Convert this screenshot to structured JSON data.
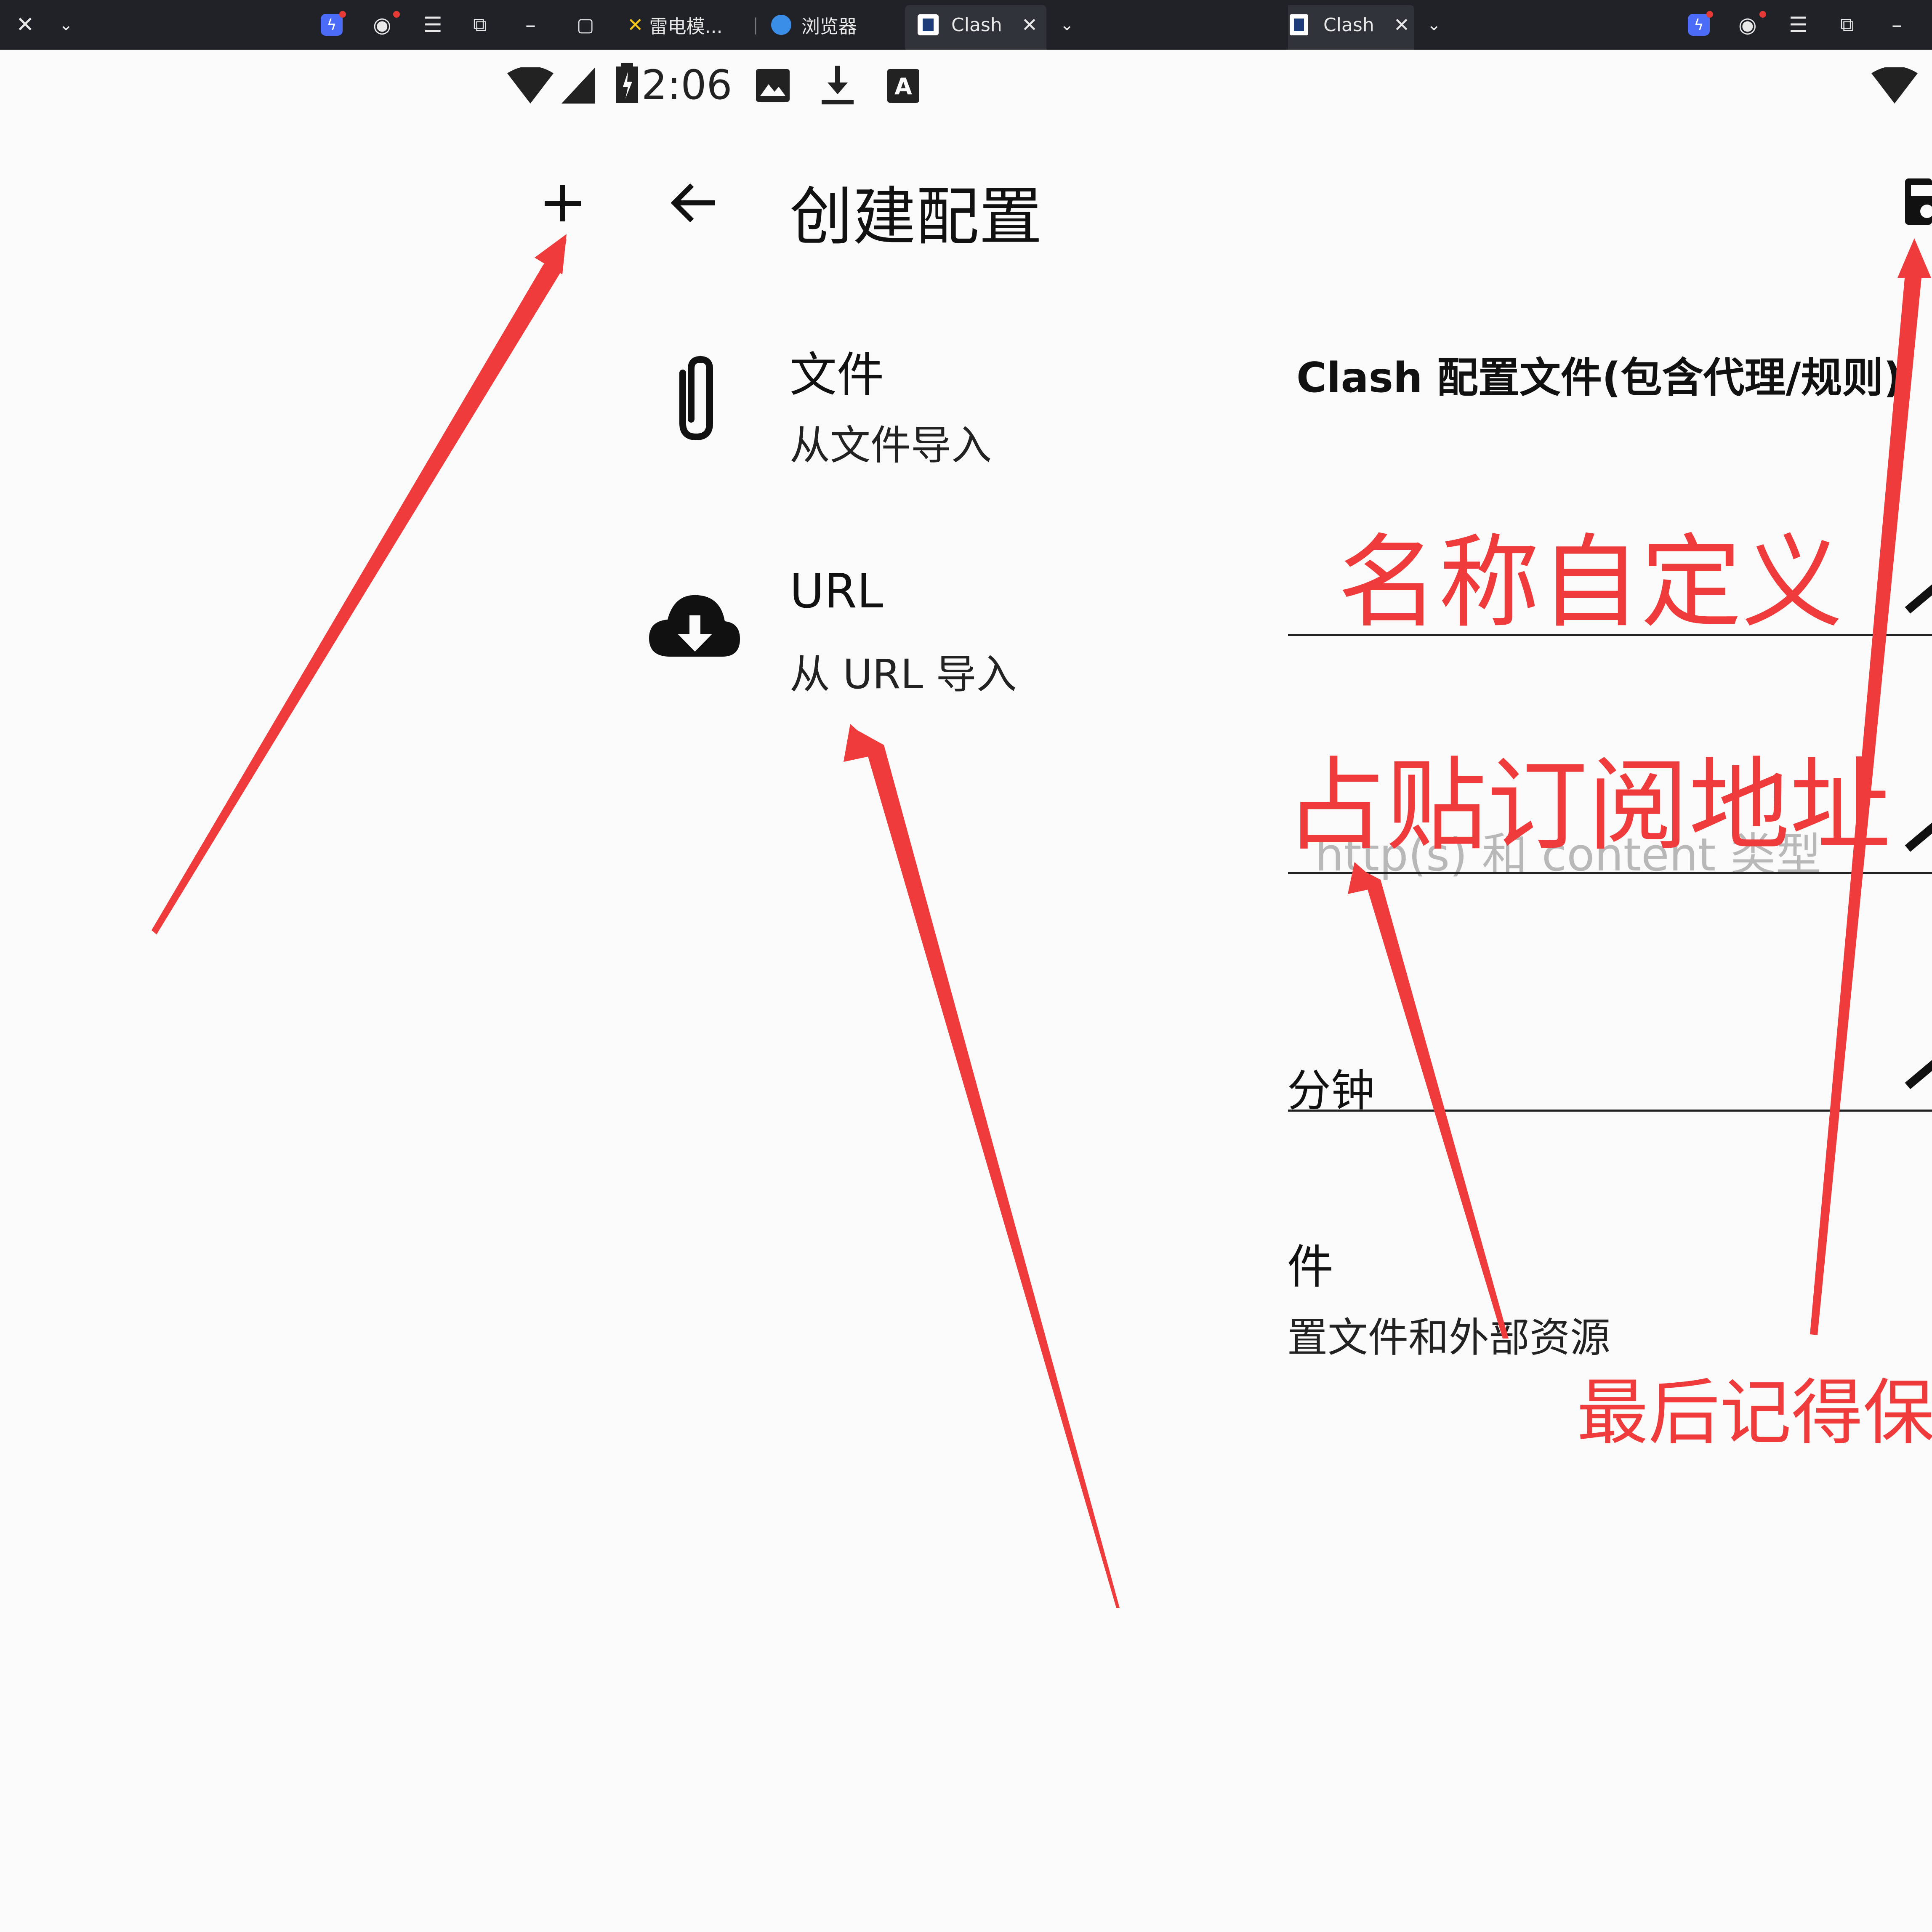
{
  "left_tabs": {
    "tab1_label": "雷电模...",
    "tab2_label": "浏览器",
    "tab3_label": "Clash"
  },
  "right_tabs": {
    "tab_label": "Clash"
  },
  "status_bar": {
    "time": "2:06"
  },
  "create_config": {
    "title": "创建配置",
    "file_item": {
      "title": "文件",
      "subtitle": "从文件导入"
    },
    "url_item": {
      "title": "URL",
      "subtitle": "从 URL 导入"
    }
  },
  "right_panel": {
    "header": "Clash 配置文件(包含代理/规则)",
    "name_field_fragment": "",
    "url_field_hint": "http(s) 和 content 类型",
    "url_hint_prefix": "",
    "interval_label_fragment": "",
    "interval_value_fragment": "分钟",
    "files_title_fragment": "件",
    "files_subtitle_fragment": "置文件和外部资源"
  },
  "annotations": {
    "name_custom": "名称自定义",
    "paste_subscription": "占贴订阅地址",
    "remember_save": "最后记得保存"
  },
  "icons": {
    "add": "plus-icon",
    "back": "arrow-left-icon",
    "file": "paperclip-icon",
    "url": "cloud-download-icon",
    "save": "save-icon"
  },
  "colors": {
    "annotation_red": "#ef3b3b",
    "topbar": "#202227",
    "background": "#fafafa"
  }
}
